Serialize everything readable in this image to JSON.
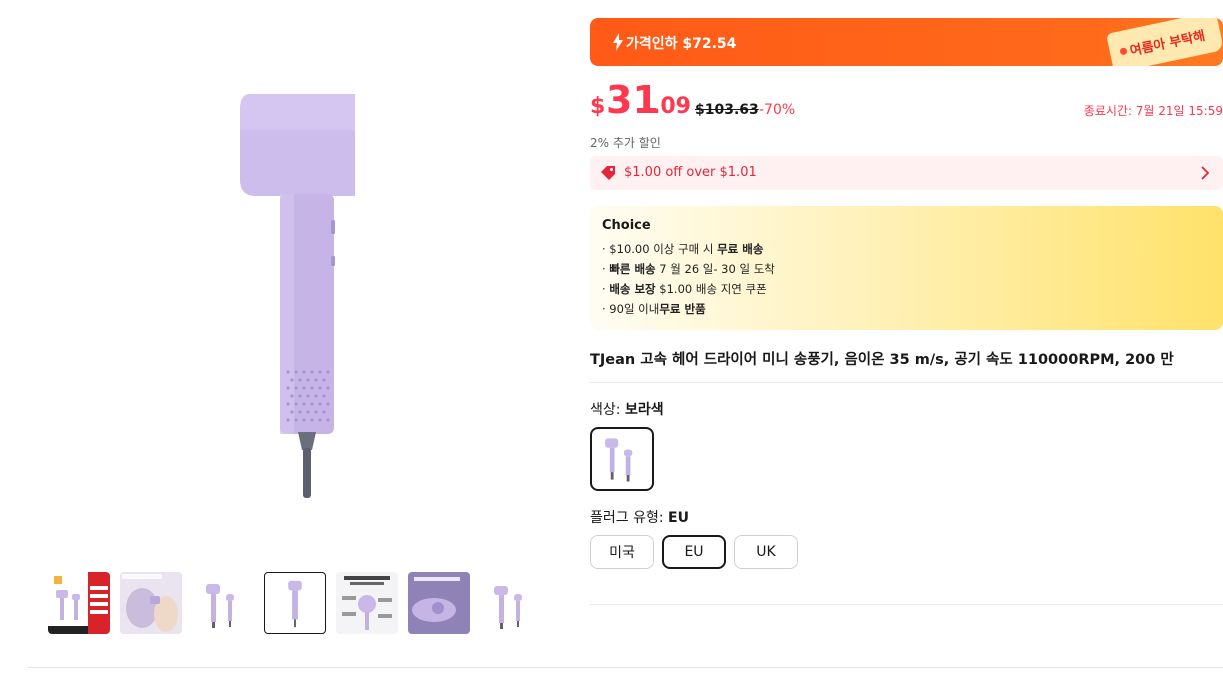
{
  "deal": {
    "label": "가격인하 $72.54",
    "tag": "여름아 부탁해"
  },
  "price": {
    "currency": "$",
    "integer": "31",
    "decimal": ".09",
    "original": "$103.63",
    "discount": "-70%",
    "ends": "종료시간: 7월 21일 15:59",
    "extra": "2% 추가 할인"
  },
  "coupon": {
    "text": "$1.00 off over $1.01"
  },
  "choice": {
    "title": "Choice",
    "line1_a": "· $10.00 이상 구매 시 ",
    "line1_b": "무료 배송",
    "line2_a": "· ",
    "line2_b": "빠른 배송",
    "line2_c": " 7 월 26 일- 30 일 도착",
    "line3_a": "· ",
    "line3_b": "배송 보장",
    "line3_c": "  $1.00 배송 지연 쿠폰",
    "line4_a": "· 90일 이내",
    "line4_b": "무료 반품"
  },
  "product": {
    "title": "TJean 고속 헤어 드라이어 미니 송풍기, 음이온 35 m/s, 공기 속도 110000RPM, 200 만"
  },
  "color": {
    "label": "색상: ",
    "value": "보라색"
  },
  "plug": {
    "label": "플러그 유형: ",
    "value": "EU",
    "options": [
      "미국",
      "EU",
      "UK"
    ]
  },
  "colors": {
    "accent": "#fd384f",
    "deal_orange": "#ff5a17",
    "product_lilac": "#c9b8e8"
  }
}
